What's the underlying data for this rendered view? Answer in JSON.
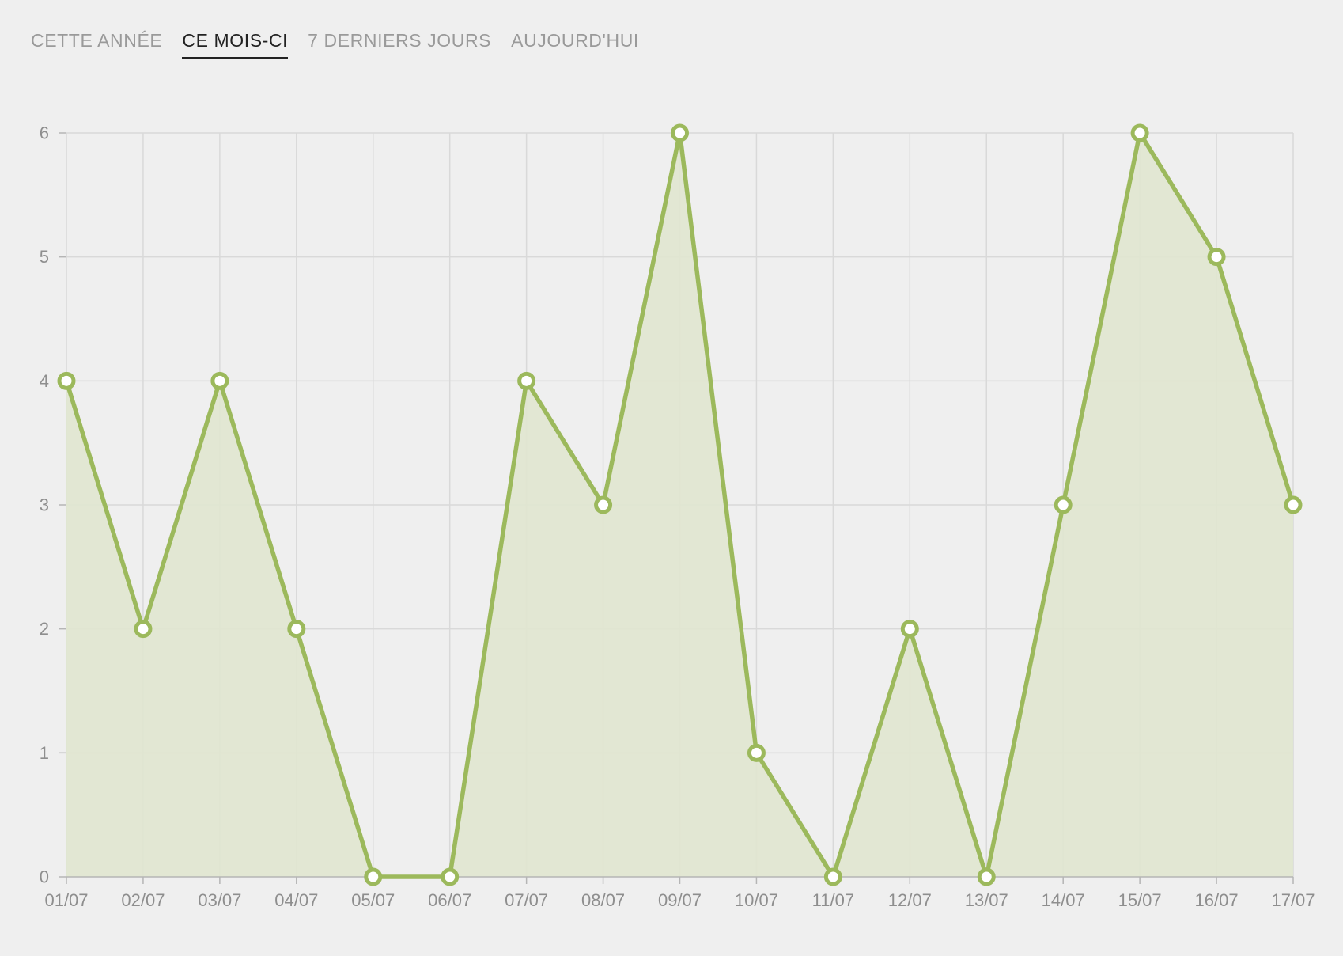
{
  "tabs": [
    {
      "label": "CETTE ANNÉE",
      "active": false
    },
    {
      "label": "CE MOIS-CI",
      "active": true
    },
    {
      "label": "7 DERNIERS JOURS",
      "active": false
    },
    {
      "label": "AUJOURD'HUI",
      "active": false
    }
  ],
  "colors": {
    "line": "#9cb95c",
    "fill": "#e0e6cf",
    "point_fill": "#ffffff",
    "grid": "#d9d9d9",
    "axis": "#b5b5b5",
    "active_tab": "#222222",
    "inactive_tab": "#9a9a9a"
  },
  "chart_data": {
    "type": "area",
    "categories": [
      "01/07",
      "02/07",
      "03/07",
      "04/07",
      "05/07",
      "06/07",
      "07/07",
      "08/07",
      "09/07",
      "10/07",
      "11/07",
      "12/07",
      "13/07",
      "14/07",
      "15/07",
      "16/07",
      "17/07"
    ],
    "series": [
      {
        "values": [
          4,
          2,
          4,
          2,
          0,
          0,
          4,
          3,
          6,
          1,
          0,
          2,
          0,
          3,
          6,
          5,
          3
        ]
      }
    ],
    "yticks": [
      "0",
      "1",
      "2",
      "3",
      "4",
      "5",
      "6"
    ],
    "ylim": [
      0,
      6
    ],
    "grid": true
  }
}
